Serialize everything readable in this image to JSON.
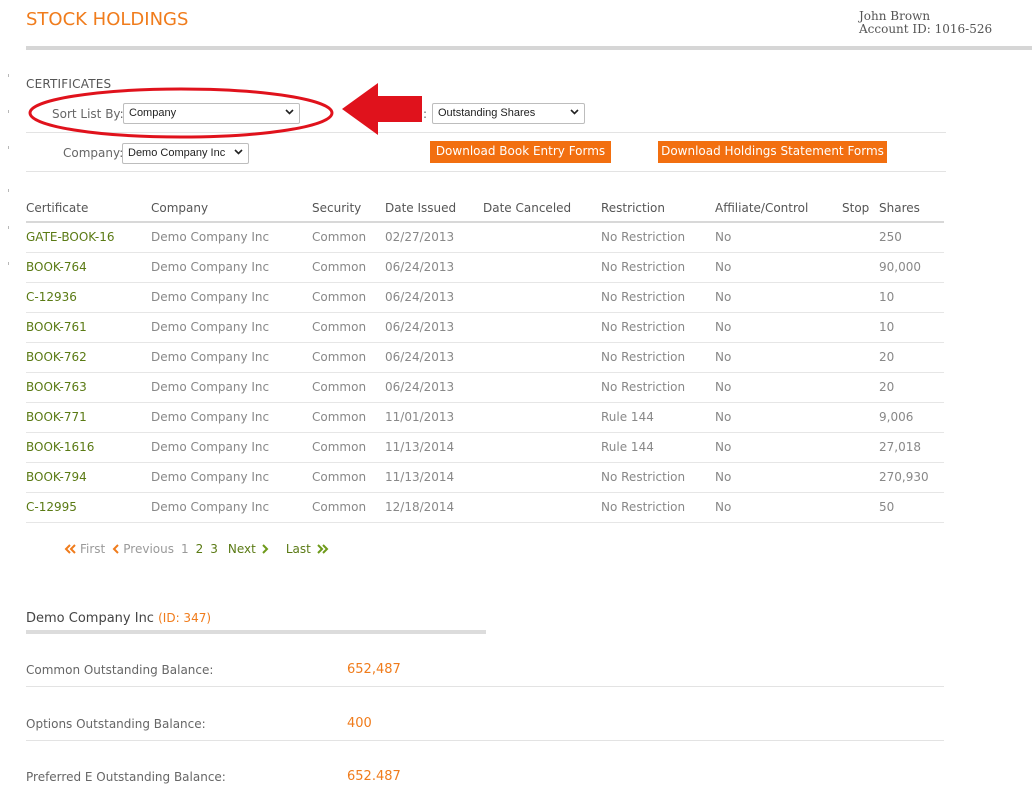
{
  "header": {
    "title": "STOCK HOLDINGS",
    "user_name": "John Brown",
    "account_id": "Account ID: 1016-526"
  },
  "certificates": {
    "section_label": "CERTIFICATES",
    "sort_label": "Sort List By:",
    "sort_value": "Company",
    "filter_value": "Outstanding Shares",
    "company_label": "Company:",
    "company_value": "Demo Company Inc",
    "btn_book_entry": "Download Book Entry Forms",
    "btn_holdings": "Download Holdings Statement Forms"
  },
  "table": {
    "columns": [
      "Certificate",
      "Company",
      "Security",
      "Date Issued",
      "Date Canceled",
      "Restriction",
      "Affiliate/Control",
      "Stop",
      "Shares"
    ],
    "rows": [
      [
        "GATE-BOOK-16",
        "Demo Company Inc",
        "Common",
        "02/27/2013",
        "",
        "No Restriction",
        "No",
        "",
        "250"
      ],
      [
        "BOOK-764",
        "Demo Company Inc",
        "Common",
        "06/24/2013",
        "",
        "No Restriction",
        "No",
        "",
        "90,000"
      ],
      [
        "C-12936",
        "Demo Company Inc",
        "Common",
        "06/24/2013",
        "",
        "No Restriction",
        "No",
        "",
        "10"
      ],
      [
        "BOOK-761",
        "Demo Company Inc",
        "Common",
        "06/24/2013",
        "",
        "No Restriction",
        "No",
        "",
        "10"
      ],
      [
        "BOOK-762",
        "Demo Company Inc",
        "Common",
        "06/24/2013",
        "",
        "No Restriction",
        "No",
        "",
        "20"
      ],
      [
        "BOOK-763",
        "Demo Company Inc",
        "Common",
        "06/24/2013",
        "",
        "No Restriction",
        "No",
        "",
        "20"
      ],
      [
        "BOOK-771",
        "Demo Company Inc",
        "Common",
        "11/01/2013",
        "",
        "Rule 144",
        "No",
        "",
        "9,006"
      ],
      [
        "BOOK-1616",
        "Demo Company Inc",
        "Common",
        "11/13/2014",
        "",
        "Rule 144",
        "No",
        "",
        "27,018"
      ],
      [
        "BOOK-794",
        "Demo Company Inc",
        "Common",
        "11/13/2014",
        "",
        "No Restriction",
        "No",
        "",
        "270,930"
      ],
      [
        "C-12995",
        "Demo Company Inc",
        "Common",
        "12/18/2014",
        "",
        "No Restriction",
        "No",
        "",
        "50"
      ]
    ]
  },
  "pager": {
    "first": "First",
    "previous": "Previous",
    "pages": [
      "1",
      "2",
      "3"
    ],
    "current_page": "1",
    "next": "Next",
    "last": "Last"
  },
  "summary": {
    "company_name": "Demo Company Inc",
    "company_id": "(ID: 347)",
    "balances": [
      {
        "label": "Common Outstanding Balance:",
        "value": "652,487"
      },
      {
        "label": "Options Outstanding Balance:",
        "value": "400"
      },
      {
        "label": "Preferred E Outstanding Balance:",
        "value": "652.487"
      }
    ]
  },
  "colors": {
    "accent_orange": "#f07c1c",
    "button_orange": "#f26f10",
    "link_green": "#5a7a14",
    "annotation_red": "#e0121c"
  }
}
